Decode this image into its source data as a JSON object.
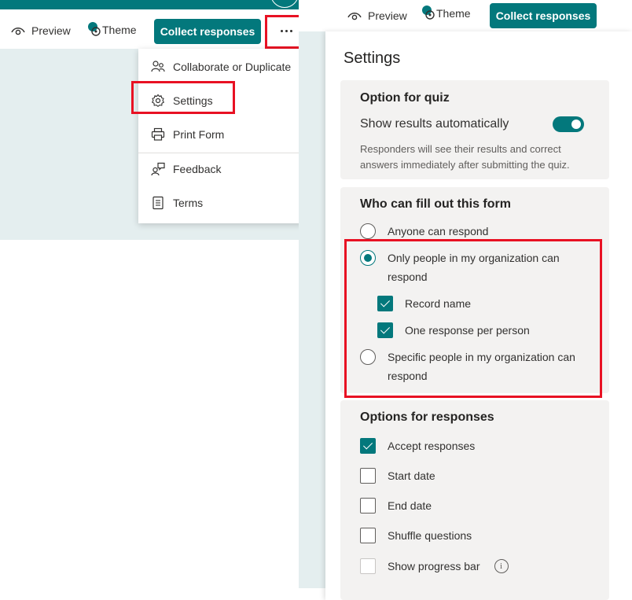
{
  "toolbar": {
    "preview_label": "Preview",
    "theme_label": "Theme",
    "collect_label": "Collect responses",
    "more_label": "···"
  },
  "menu": {
    "items": [
      {
        "label": "Collaborate or Duplicate",
        "icon": "people-icon"
      },
      {
        "label": "Settings",
        "icon": "gear-icon"
      },
      {
        "label": "Print Form",
        "icon": "printer-icon"
      },
      {
        "label": "Feedback",
        "icon": "feedback-icon"
      },
      {
        "label": "Terms",
        "icon": "document-icon"
      }
    ]
  },
  "settings": {
    "title": "Settings",
    "quiz": {
      "title": "Option for quiz",
      "toggle_label": "Show results automatically",
      "toggle_on": true,
      "hint": "Responders will see their results and correct answers immediately after submitting the quiz."
    },
    "who": {
      "title": "Who can fill out this form",
      "options": [
        {
          "label": "Anyone can respond",
          "selected": false
        },
        {
          "label": "Only people in my organization can respond",
          "selected": true
        },
        {
          "label": "Specific people in my organization can respond",
          "selected": false
        }
      ],
      "sub_options": [
        {
          "label": "Record name",
          "checked": true
        },
        {
          "label": "One response per person",
          "checked": true
        }
      ]
    },
    "responses": {
      "title": "Options for responses",
      "options": [
        {
          "label": "Accept responses",
          "checked": true
        },
        {
          "label": "Start date",
          "checked": false
        },
        {
          "label": "End date",
          "checked": false
        },
        {
          "label": "Shuffle questions",
          "checked": false
        },
        {
          "label": "Show progress bar",
          "checked": false
        }
      ],
      "info_glyph": "i"
    }
  },
  "colors": {
    "accent": "#03787c",
    "highlight": "#e81123",
    "canvas": "#e4eeef",
    "card": "#f3f2f1"
  }
}
